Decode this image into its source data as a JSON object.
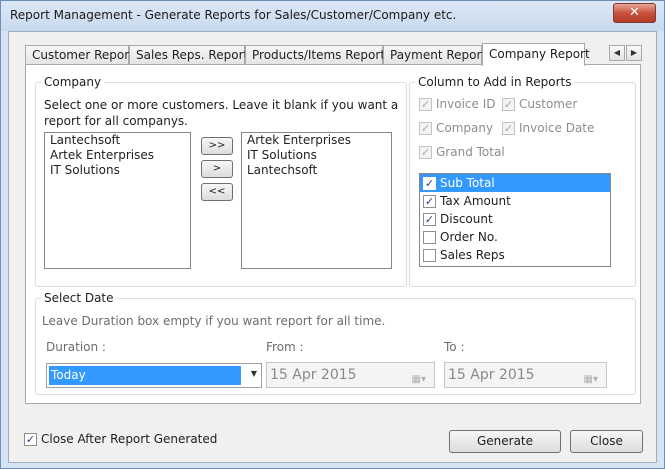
{
  "window": {
    "title": "Report Management - Generate Reports for Sales/Customer/Company etc.",
    "close_glyph": "✕"
  },
  "tabs": [
    {
      "label": "Customer Report"
    },
    {
      "label": "Sales Reps. Report"
    },
    {
      "label": "Products/Items Report"
    },
    {
      "label": "Payment Report"
    },
    {
      "label": "Company Report"
    }
  ],
  "tab_scroll": {
    "left": "◀",
    "right": "▶"
  },
  "company_group": {
    "legend": "Company",
    "hint_line1": "Select one or more customers. Leave it blank if you want a",
    "hint_line2": "report for all companys.",
    "available": [
      "Lantechsoft",
      "Artek Enterprises",
      "IT Solutions"
    ],
    "selected": [
      "Artek Enterprises",
      "IT Solutions",
      "Lantechsoft"
    ],
    "btn_add_all": ">>",
    "btn_add": ">",
    "btn_remove_all": "<<"
  },
  "columns_group": {
    "legend": "Column to Add in Reports",
    "fixed": [
      {
        "label": "Invoice ID",
        "checked": true
      },
      {
        "label": "Customer",
        "checked": true
      },
      {
        "label": "Company",
        "checked": true
      },
      {
        "label": "Invoice Date",
        "checked": true
      },
      {
        "label": "Grand Total",
        "checked": true
      }
    ],
    "optional": [
      {
        "label": "Sub Total",
        "checked": true,
        "selected": true
      },
      {
        "label": "Tax Amount",
        "checked": true,
        "selected": false
      },
      {
        "label": "Discount",
        "checked": true,
        "selected": false
      },
      {
        "label": "Order No.",
        "checked": false,
        "selected": false
      },
      {
        "label": "Sales Reps",
        "checked": false,
        "selected": false
      }
    ]
  },
  "date_group": {
    "legend": "Select Date",
    "hint": "Leave Duration box empty if you want report for all time.",
    "duration_label": "Duration :",
    "duration_value": "Today",
    "from_label": "From :",
    "from_value": "15 Apr 2015",
    "to_label": "To :",
    "to_value": "15 Apr 2015"
  },
  "footer": {
    "close_after_label": "Close After Report Generated",
    "close_after_checked": true,
    "generate_label": "Generate",
    "close_label": "Close"
  },
  "glyphs": {
    "check": "✓",
    "dropdown": "▼",
    "calendar": "▦▾"
  }
}
